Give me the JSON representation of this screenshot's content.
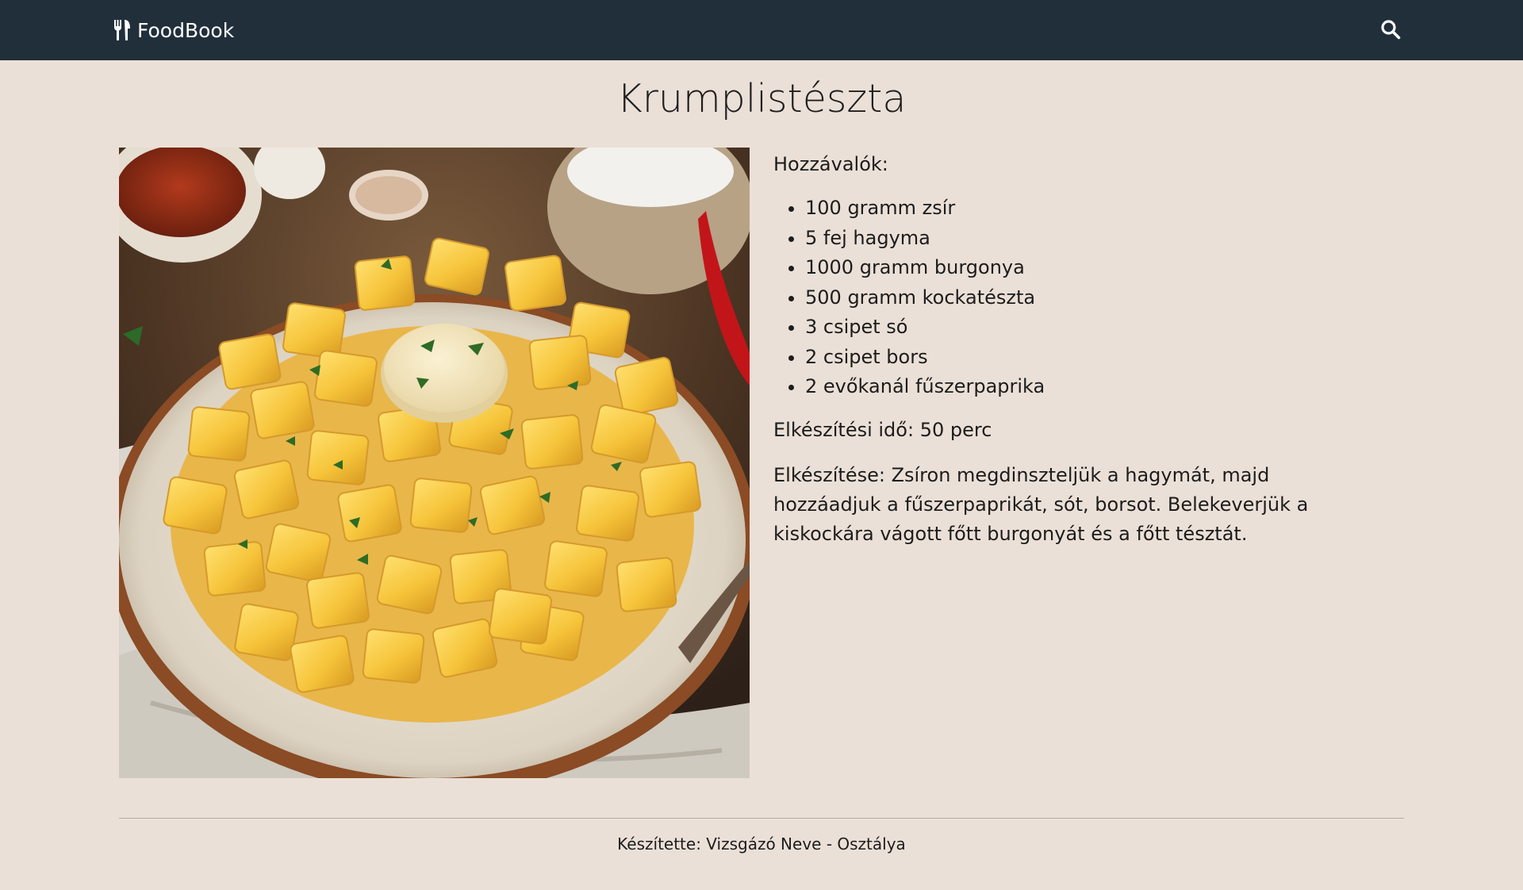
{
  "navbar": {
    "brand_text": "FoodBook",
    "brand_icon": "utensils-icon",
    "search_icon": "search-icon"
  },
  "recipe": {
    "title": "Krumplistészta",
    "ingredients_title": "Hozzávalók:",
    "ingredients": [
      "100 gramm zsír",
      "5 fej hagyma",
      "1000 gramm burgonya",
      "500 gramm kockatészta",
      "3 csipet só",
      "2 csipet bors",
      "2 evőkanál fűszerpaprika"
    ],
    "prep_time": "Elkészítési idő: 50 perc",
    "method": "Elkészítése: Zsíron megdinszteljük a hagymát, majd hozzáadjuk a fűszerpaprikát, sót, borsot. Belekeverjük a kiskockára vágott főtt burgonyát és a főtt tésztát."
  },
  "footer": {
    "text": "Készítette: Vizsgázó Neve - Osztálya"
  },
  "colors": {
    "navbar_bg": "#212f3b",
    "page_bg": "#ebe0d7"
  }
}
